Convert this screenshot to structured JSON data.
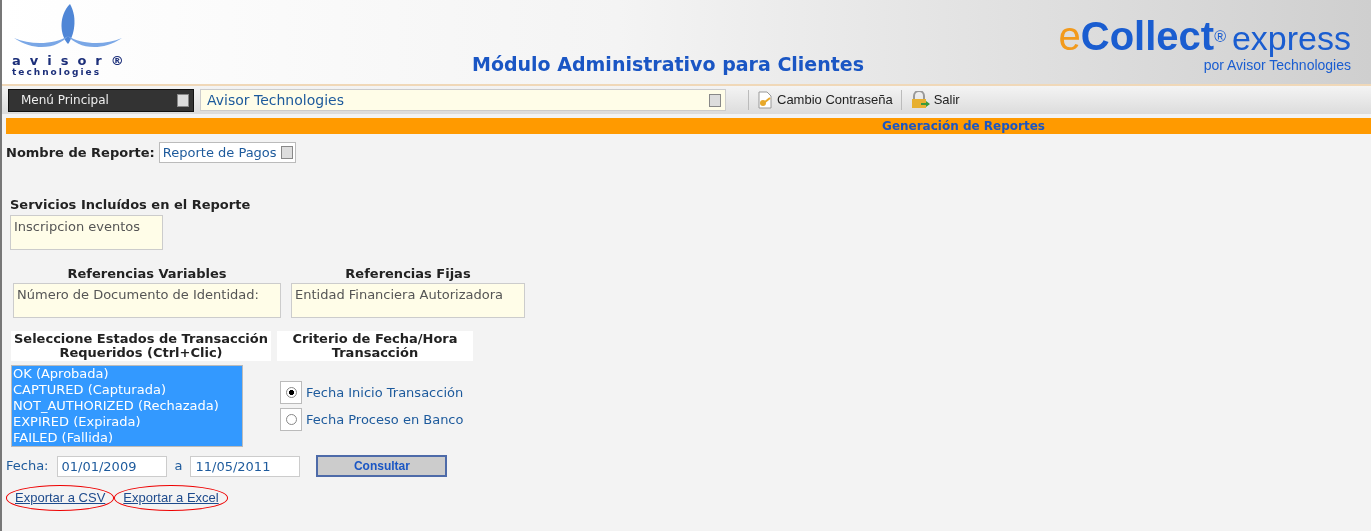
{
  "header": {
    "logo": {
      "name": "avisor",
      "mark": "®",
      "subtitle": "technologies"
    },
    "title": "Módulo Administrativo para Clientes",
    "brand": {
      "prefix": "e",
      "name": "Collect",
      "mark": "®",
      "suffix": "express",
      "byline": "por Avisor Technologies"
    }
  },
  "toolbar": {
    "menu": {
      "label": "Menú Principal"
    },
    "client_select": {
      "value": "Avisor Technologies"
    },
    "actions": [
      {
        "kind": "password",
        "label": "Cambio Contraseña"
      },
      {
        "kind": "logout",
        "label": "Salir"
      }
    ]
  },
  "section_title": "Generación de Reportes",
  "report": {
    "label": "Nombre de Reporte:",
    "value": "Reporte de Pagos"
  },
  "services": {
    "heading": "Servicios Incluídos en el Reporte",
    "value": "Inscripcion eventos"
  },
  "references": [
    {
      "heading": "Referencias Variables",
      "value": "Número de Documento de Identidad:"
    },
    {
      "heading": "Referencias Fijas",
      "value": "Entidad Financiera Autorizadora"
    }
  ],
  "states": {
    "heading": "Seleccione Estados de Transacción Requeridos (Ctrl+Clic)",
    "options": [
      {
        "label": "OK (Aprobada)",
        "selected": true
      },
      {
        "label": "CAPTURED (Capturada)",
        "selected": true
      },
      {
        "label": "NOT_AUTHORIZED (Rechazada)",
        "selected": true
      },
      {
        "label": "EXPIRED (Expirada)",
        "selected": true
      },
      {
        "label": "FAILED (Fallida)",
        "selected": true
      }
    ]
  },
  "criteria": {
    "heading": "Criterio de Fecha/Hora Transacción",
    "options": [
      {
        "label": "Fecha Inicio Transacción",
        "selected": true
      },
      {
        "label": "Fecha Proceso en Banco",
        "selected": false
      }
    ]
  },
  "dates": {
    "label": "Fecha:",
    "from": "01/01/2009",
    "separator": "a",
    "to": "11/05/2011",
    "button": "Consultar"
  },
  "exports": [
    {
      "label": "Exportar a CSV",
      "highlighted": true
    },
    {
      "label": "Exportar a Excel",
      "highlighted": true
    }
  ]
}
